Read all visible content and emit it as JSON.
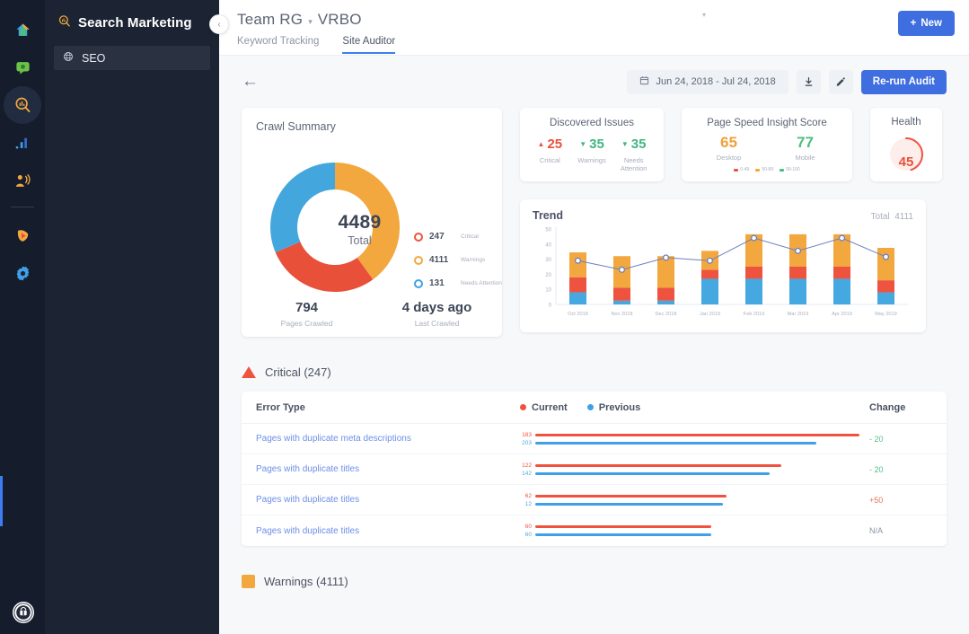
{
  "rail": {
    "items": [
      {
        "name": "home-icon",
        "label": "Home"
      },
      {
        "name": "chat-icon",
        "label": "Messages"
      },
      {
        "name": "search-marketing-icon",
        "label": "Search Marketing"
      },
      {
        "name": "analytics-icon",
        "label": "Analytics"
      },
      {
        "name": "audience-icon",
        "label": "Audience"
      },
      {
        "name": "media-icon",
        "label": "Media"
      },
      {
        "name": "settings-icon",
        "label": "Settings"
      }
    ],
    "avatar_label": "User"
  },
  "subnav": {
    "title": "Search Marketing",
    "title_icon": "search-chart-icon",
    "items": [
      {
        "label": "SEO",
        "icon": "globe-icon",
        "active": true
      }
    ],
    "collapse_glyph": "‹"
  },
  "topbar": {
    "team": "Team RG",
    "separator": "▾",
    "site": "VRBO",
    "tabs": [
      {
        "label": "Keyword Tracking",
        "active": false
      },
      {
        "label": "Site Auditor",
        "active": true
      }
    ],
    "new_button": "New",
    "new_button_glyph": "+",
    "caret_glyph": "▾"
  },
  "actionbar": {
    "back_glyph": "←",
    "date_range": "Jun 24, 2018 - Jul 24, 2018",
    "calendar_icon": "calendar-icon",
    "download_icon": "download-icon",
    "edit_icon": "pencil-icon",
    "rerun_label": "Re-run Audit"
  },
  "crawl_summary": {
    "title": "Crawl Summary",
    "total_value": "4489",
    "total_label": "Total",
    "legend": [
      {
        "value": "247",
        "label": "Critical",
        "color": "#ef5340"
      },
      {
        "value": "4111",
        "label": "Warnings",
        "color": "#f2a83f"
      },
      {
        "value": "131",
        "label": "Needs Attention",
        "color": "#3fa0e8"
      }
    ],
    "stats": [
      {
        "value": "794",
        "label": "Pages Crawled"
      },
      {
        "value": "4 days ago",
        "label": "Last Crawled"
      }
    ]
  },
  "discovered_issues": {
    "title": "Discovered Issues",
    "items": [
      {
        "value": "25",
        "label": "Critical",
        "dir": "up",
        "glyph": "▲",
        "color": "#e8503a"
      },
      {
        "value": "35",
        "label": "Warnings",
        "dir": "down",
        "glyph": "▼",
        "color": "#43b581"
      },
      {
        "value": "35",
        "label": "Needs Attention",
        "dir": "down",
        "glyph": "▼",
        "color": "#43b581"
      }
    ]
  },
  "page_speed": {
    "title": "Page Speed Insight Score",
    "scores": [
      {
        "value": "65",
        "label": "Desktop",
        "tone": "orange"
      },
      {
        "value": "77",
        "label": "Mobile",
        "tone": "green"
      }
    ],
    "legend": [
      {
        "range": "0-49",
        "color": "#ef5340"
      },
      {
        "range": "50-89",
        "color": "#f2a83f"
      },
      {
        "range": "90-100",
        "color": "#4cbf7e"
      }
    ]
  },
  "health": {
    "title": "Health",
    "value": "45",
    "max": 100,
    "color": "#ef5340"
  },
  "chart_data": [
    {
      "type": "pie",
      "id": "crawl-donut",
      "title": "Crawl Summary",
      "labels": [
        "Warnings",
        "Critical",
        "Needs Attention"
      ],
      "values": [
        4111,
        247,
        131
      ],
      "display_fractions": [
        0.4,
        0.27,
        0.33
      ],
      "colors": [
        "#f2a83f",
        "#e8503a",
        "#43a7dd"
      ],
      "center_value": 4489,
      "center_label": "Total"
    },
    {
      "type": "bar",
      "id": "trend-chart",
      "title": "Trend",
      "total_label": "Total",
      "total_value": "4111",
      "stacked": true,
      "categories": [
        "Oct 2018",
        "Nov 2018",
        "Dec 2018",
        "Jan 2019",
        "Feb 2019",
        "Mar 2019",
        "Apr 2019",
        "May 2019"
      ],
      "series": [
        {
          "name": "Needs Attention",
          "color": "#45a8e0",
          "values": [
            8,
            2.5,
            2.5,
            17,
            17,
            17,
            17,
            8
          ]
        },
        {
          "name": "Critical",
          "color": "#ee5340",
          "values": [
            10,
            8.5,
            8.5,
            6,
            8,
            8,
            8,
            8
          ]
        },
        {
          "name": "Warnings",
          "color": "#f2a83f",
          "values": [
            16.5,
            21,
            21,
            12.5,
            21.5,
            21.5,
            21.5,
            21.5
          ]
        }
      ],
      "line_series": {
        "name": "Total Trend",
        "color": "#6a7fc0",
        "values": [
          29,
          23,
          31,
          29,
          44,
          35.5,
          44,
          31.5
        ]
      },
      "ylim": [
        0,
        50
      ],
      "yticks": [
        0,
        10,
        20,
        30,
        40,
        50
      ],
      "ylabel": "",
      "xlabel": "",
      "grid": false,
      "legend_position": "none"
    }
  ],
  "critical_section": {
    "title": "Critical (247)",
    "marker": "triangle",
    "marker_color": "#ef5340",
    "columns": {
      "error_type": "Error Type",
      "current": "Current",
      "previous": "Previous",
      "change": "Change"
    },
    "rows": [
      {
        "error_type": "Pages with duplicate meta descriptions",
        "current": "183",
        "previous": "203",
        "current_pct": 83,
        "previous_pct": 72,
        "change": "- 20",
        "change_tone": "pos"
      },
      {
        "error_type": "Pages with duplicate titles",
        "current": "122",
        "previous": "142",
        "current_pct": 63,
        "previous_pct": 60,
        "change": "- 20",
        "change_tone": "pos"
      },
      {
        "error_type": "Pages with duplicate titles",
        "current": "62",
        "previous": "12",
        "current_pct": 49,
        "previous_pct": 48,
        "change": "+50",
        "change_tone": "neg"
      },
      {
        "error_type": "Pages with duplicate titles",
        "current": "60",
        "previous": "60",
        "current_pct": 45,
        "previous_pct": 45,
        "change": "N/A",
        "change_tone": "na"
      }
    ]
  },
  "warnings_section": {
    "title": "Warnings  (4111)",
    "marker": "square",
    "marker_color": "#f2a83f"
  }
}
